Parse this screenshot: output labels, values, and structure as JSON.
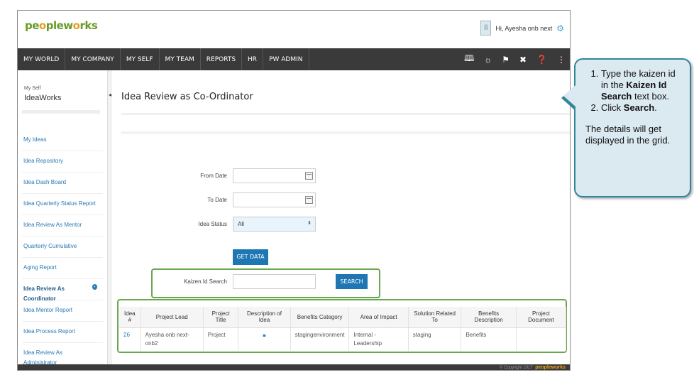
{
  "header": {
    "logo": [
      "pe",
      "o",
      "plew",
      "o",
      "rks"
    ],
    "greeting": "Hi, Ayesha onb next"
  },
  "nav": {
    "items": [
      "MY WORLD",
      "MY COMPANY",
      "MY SELF",
      "MY TEAM",
      "REPORTS",
      "HR",
      "PW ADMIN"
    ],
    "icons": [
      "book-icon",
      "lightbulb-icon",
      "flag-icon",
      "tools-icon",
      "help-icon",
      "sitemap-icon"
    ]
  },
  "sidebar": {
    "subtitle": "My Self",
    "title": "IdeaWorks",
    "items": [
      "My Ideas",
      "Idea Repository",
      "Idea Dash Board",
      "Idea Quarterly Status Report",
      "Idea Review As Mentor",
      "Quarterly Cumulative",
      "Aging Report",
      "Idea Review As Coordinator",
      "Idea Mentor Report",
      "Idea Process Report",
      "Idea Review As Administrator"
    ],
    "active_index": 7
  },
  "main": {
    "page_title": "Idea Review as Co-Ordinator",
    "from_date_label": "From Date",
    "from_date_value": "",
    "to_date_label": "To Date",
    "to_date_value": "",
    "idea_status_label": "Idea Status",
    "idea_status_value": "All",
    "get_data_label": "GET DATA",
    "kaizen_label": "Kaizen Id Search",
    "kaizen_value": "",
    "search_label": "SEARCH"
  },
  "grid": {
    "columns": [
      "Idea #",
      "Project Lead",
      "Project Title",
      "Description of Idea",
      "Benefits Category",
      "Area of Impact",
      "Solution Related To",
      "Benefits Description",
      "Project Document"
    ],
    "rows": [
      {
        "idea": "26",
        "lead": "Ayesha onb next-onb2",
        "title": "Project",
        "description_icon": "lock-icon",
        "benefits_category": "stagingenvironment",
        "area": "Internal - Leadership",
        "solution": "staging",
        "benefits_description": "Benefits",
        "document": ""
      }
    ]
  },
  "footer": {
    "copyright": "© Copyright 2017",
    "brand": "peopleworks"
  },
  "callout": {
    "step1_pre": "Type the kaizen id in the ",
    "step1_bold": "Kaizen Id Search",
    "step1_post": " text box.",
    "step2_pre": "Click ",
    "step2_bold": "Search",
    "step2_post": ".",
    "note": "The details will get displayed in the grid."
  },
  "colors": {
    "navbar": "#3a3a3a",
    "accent": "#1e76b3",
    "highlight_border": "#6aa84f",
    "callout_border": "#31859c",
    "callout_fill": "#dbe9f0"
  }
}
